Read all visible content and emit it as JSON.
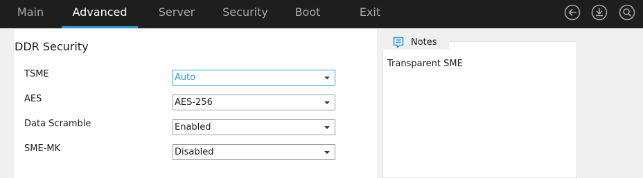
{
  "nav": {
    "tabs": [
      {
        "label": "Main",
        "active": false
      },
      {
        "label": "Advanced",
        "active": true
      },
      {
        "label": "Server",
        "active": false
      },
      {
        "label": "Security",
        "active": false
      },
      {
        "label": "Boot",
        "active": false
      },
      {
        "label": "Exit",
        "active": false
      }
    ],
    "icons": [
      "back-icon",
      "save-download-icon",
      "search-icon"
    ],
    "accent_color": "#2a9be0"
  },
  "section": {
    "title": "DDR Security",
    "fields": [
      {
        "label": "TSME",
        "value": "Auto",
        "focused": true
      },
      {
        "label": "AES",
        "value": "AES-256",
        "focused": false
      },
      {
        "label": "Data Scramble",
        "value": "Enabled",
        "focused": false
      },
      {
        "label": "SME-MK",
        "value": "Disabled",
        "focused": false
      }
    ]
  },
  "notes": {
    "title": "Notes",
    "icon": "notes-icon",
    "text": "Transparent SME"
  }
}
